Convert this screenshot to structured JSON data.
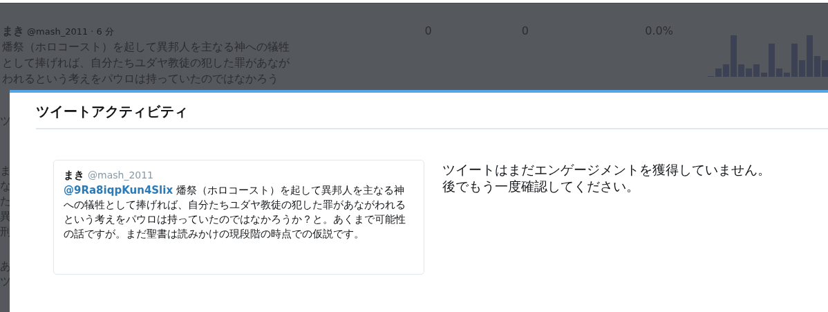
{
  "background_tweet": {
    "name": "まき",
    "handle": "@mash_2011",
    "time": "· 6 分",
    "text_lines": [
      "燔祭（ホロコースト）を起して異邦人を主なる神への犠牲",
      "として捧げれば、自分たちユダヤ教徒の犯した罪があなが",
      "われるという考えをパウロは持っていたのではなかろう"
    ],
    "stats": [
      "0",
      "0",
      "0.0%"
    ]
  },
  "left_edge_fragments": [
    "ツ",
    "ま",
    "な",
    "た",
    "異",
    "刑",
    "あ",
    "ツ"
  ],
  "modal": {
    "title": "ツイートアクティビティ",
    "tweet_card": {
      "name": "まき",
      "handle": "@mash_2011",
      "mention": "@9Ra8iqpKun4Slix",
      "text": "燔祭（ホロコースト）を起して異邦人を主なる神への犠牲として捧げれば、自分たちユダヤ教徒の犯した罪があながわれるという考えをパウロは持っていたのではなかろうか？と。あくまで可能性の話ですが。まだ聖書は読みかけの現段階の時点での仮説です。"
    },
    "empty_message": [
      "ツイートはまだエンゲージメントを獲得していません。",
      "後でもう一度確認してください。"
    ]
  }
}
